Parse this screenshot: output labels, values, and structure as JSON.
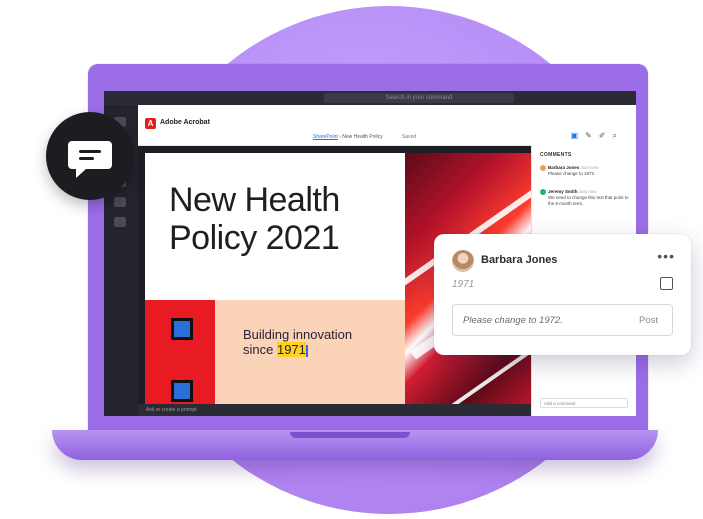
{
  "app": {
    "search_placeholder": "Search in your command",
    "name": "Adobe Acrobat",
    "logo_letter": "A",
    "breadcrumb": {
      "link": "SharePoint",
      "separator": " › ",
      "current": "New Health Policy",
      "saved": "Saved"
    }
  },
  "document": {
    "title_line1": "New Health",
    "title_line2": "Policy 2021",
    "subtitle_line1": "Building innovation",
    "subtitle_prefix": "since ",
    "subtitle_highlight": "1971"
  },
  "comments_panel": {
    "heading": "COMMENTS",
    "items": [
      {
        "author": "Barbara Jones",
        "time": "Just now",
        "text": "Please change to 1972.",
        "color": "#f0a05a"
      },
      {
        "author": "Jeremy Smith",
        "time": "Just now",
        "text": "We need to change this text that point to the 6 month term.",
        "color": "#20b27a"
      }
    ],
    "add_placeholder": "Add a comment"
  },
  "bottombar": {
    "text": "Ask or create a prompt"
  },
  "comment_card": {
    "author": "Barbara Jones",
    "more": "•••",
    "quoted_text": "1971",
    "reply_placeholder": "Please change to 1972.",
    "post_label": "Post"
  },
  "colors": {
    "purple_circle": "#b58cf5",
    "laptop": "#9b6ee8",
    "acrobat_red": "#e0201b",
    "highlight": "#ffd21f",
    "band": "#fbd3b8"
  },
  "icons": [
    "chat-icon",
    "comment-tool-icon",
    "pen-icon",
    "highlighter-icon",
    "search-icon",
    "more-icon",
    "checkbox-icon"
  ]
}
